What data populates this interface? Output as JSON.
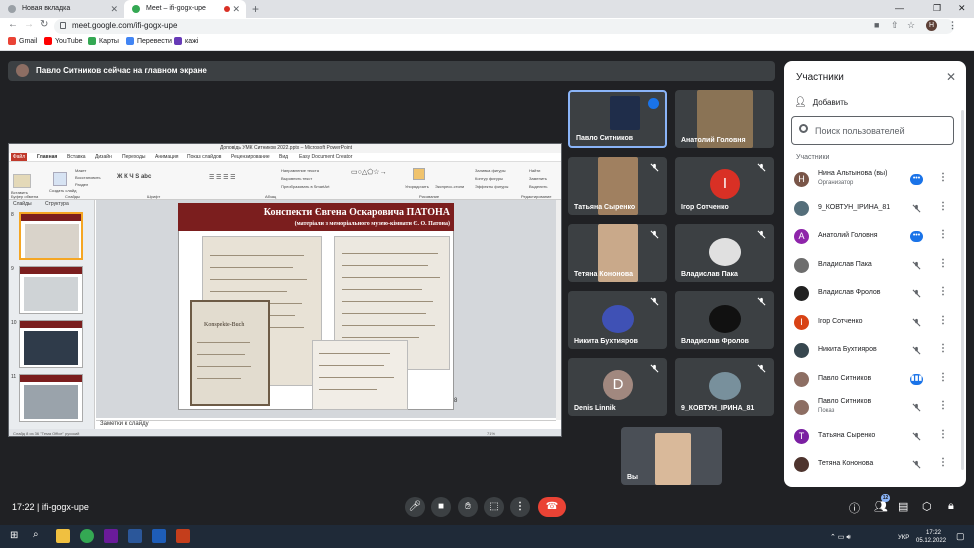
{
  "browser": {
    "tabs": [
      {
        "label": "Новая вкладка"
      },
      {
        "label": "Meet – ifi-gogx-upe"
      }
    ],
    "new_tab": "+",
    "url": "meet.google.com/ifi-gogx-upe",
    "profile_initial": "H",
    "bookmarks": [
      "Gmail",
      "YouTube",
      "Карты",
      "Перевести",
      "кажі"
    ]
  },
  "meet": {
    "banner": "Павло Ситников сейчас на главном экране",
    "presentation": {
      "window_title": "Доповідь УМК Ситников 2022.pptx – Microsoft PowerPoint",
      "file_tab": "Файл",
      "ribbon_tabs": [
        "Главная",
        "Вставка",
        "Дизайн",
        "Переходы",
        "Анимация",
        "Показ слайдов",
        "Рецензирование",
        "Вид",
        "Easy Document Creator"
      ],
      "ribbon_groups": [
        "Буфер обмена",
        "Слайды",
        "Шрифт",
        "Абзац",
        "Рисование",
        "Редактирование"
      ],
      "ribbon_buttons": [
        "Вставить",
        "Создать слайд",
        "Макет",
        "Восстановить",
        "Раздел",
        "Упорядочить",
        "Экспресс-стили",
        "Найти",
        "Заменить",
        "Выделить",
        "Направление текста",
        "Выровнять текст",
        "Преобразовать в SmartArt",
        "Заливка фигуры",
        "Контур фигуры",
        "Эффекты фигуры"
      ],
      "panel_tabs": [
        "Слайды",
        "Структура"
      ],
      "thumb_numbers": [
        "8",
        "9",
        "10",
        "11"
      ],
      "slide_title": "Конспекти Євгена Оскаровича ПАТОНА",
      "slide_subtitle": "(матеріали з меморіального музею-кімнати Є. О. Патона)",
      "slide_number": "8",
      "doc_label": "Konspekte-Buch",
      "notes": "Заметки к слайду",
      "status_left": "Слайд 8 из 36   \"Тема Office\"   русский",
      "status_right": "71%"
    },
    "tiles": [
      {
        "name": "Павло Ситников",
        "state": "speaking"
      },
      {
        "name": "Анатолий Головня",
        "state": "video"
      },
      {
        "name": "Тaтьяна Сыренко",
        "state": "muted"
      },
      {
        "name": "Ігор Сотченко",
        "state": "muted",
        "initial": "I",
        "color": "#d93025"
      },
      {
        "name": "Тетяна Кононова",
        "state": "muted"
      },
      {
        "name": "Владислав Пака",
        "state": "muted"
      },
      {
        "name": "Никита Бухтияров",
        "state": "muted"
      },
      {
        "name": "Владислав Фролов",
        "state": "muted"
      },
      {
        "name": "Denis Linnik",
        "state": "muted",
        "initial": "D",
        "color": "#a1887f"
      },
      {
        "name": "9_КОВТУН_ІРИНА_81",
        "state": "muted"
      }
    ],
    "self_view": {
      "name": "Вы"
    },
    "meeting_time": "17:22",
    "meeting_code": "ifi-gogx-upe",
    "participant_badge": "12",
    "accent": "#1a73e8",
    "hangup_color": "#ea4335"
  },
  "participants": {
    "title": "Участники",
    "add": "Добавить",
    "search_placeholder": "Поиск пользователей",
    "section": "Участники",
    "rows": [
      {
        "name": "Нина Альтынова (вы)",
        "sub": "Организатор",
        "initial": "Н",
        "color": "#795548",
        "status": "dots"
      },
      {
        "name": "9_КОВТУН_ІРИНА_81",
        "sub": "",
        "initial": "",
        "color": "#546e7a",
        "status": "muted"
      },
      {
        "name": "Анатолий Головня",
        "sub": "",
        "initial": "А",
        "color": "#8e24aa",
        "status": "dots"
      },
      {
        "name": "Владислав Пака",
        "sub": "",
        "initial": "",
        "color": "#6d6d6d",
        "status": "muted"
      },
      {
        "name": "Владислав Фролов",
        "sub": "",
        "initial": "",
        "color": "#212121",
        "status": "muted"
      },
      {
        "name": "Ігор Сотченко",
        "sub": "",
        "initial": "І",
        "color": "#d84315",
        "status": "muted"
      },
      {
        "name": "Никита Бухтияров",
        "sub": "",
        "initial": "",
        "color": "#37474f",
        "status": "muted"
      },
      {
        "name": "Павло Ситников",
        "sub": "",
        "initial": "",
        "color": "#8d6e63",
        "status": "speaking"
      },
      {
        "name": "Павло Ситников",
        "sub": "Показ",
        "initial": "",
        "color": "#8d6e63",
        "status": "present"
      },
      {
        "name": "Тaтьяна Сыренко",
        "sub": "",
        "initial": "Т",
        "color": "#7b1fa2",
        "status": "muted"
      },
      {
        "name": "Тетяна Кононова",
        "sub": "",
        "initial": "",
        "color": "#4e342e",
        "status": "muted"
      }
    ]
  },
  "taskbar": {
    "lang": "УКР",
    "time": "17:22",
    "date": "05.12.2022"
  }
}
